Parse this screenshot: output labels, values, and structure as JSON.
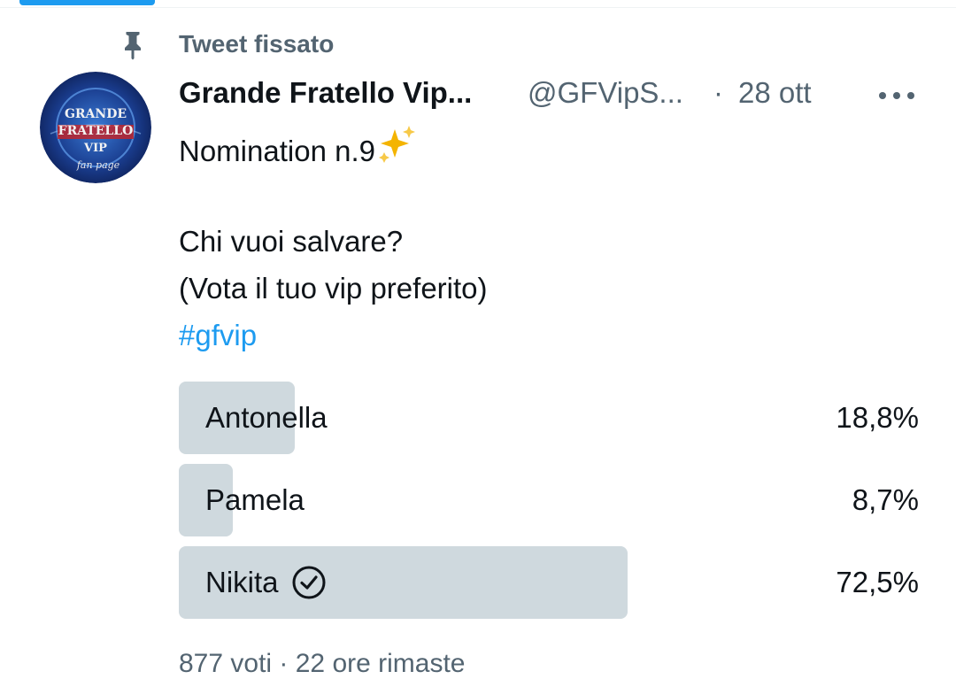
{
  "pinned": {
    "label": "Tweet fissato",
    "icon": "pin-icon"
  },
  "avatar": {
    "lines": [
      "GRANDE",
      "FRATELLO",
      "VIP",
      "fan page"
    ]
  },
  "tweet": {
    "author_name": "Grande Fratello Vip...",
    "handle": "@GFVipS...",
    "separator": "·",
    "date": "28 ott",
    "line1": "Nomination n.9",
    "line2": "Chi vuoi salvare?",
    "line3": "(Vota il tuo vip preferito)",
    "hashtag": "#gfvip"
  },
  "poll": {
    "options": [
      {
        "label": "Antonella",
        "percent_text": "18,8%",
        "percent": 18.8,
        "winner": false
      },
      {
        "label": "Pamela",
        "percent_text": "8,7%",
        "percent": 8.7,
        "winner": false
      },
      {
        "label": "Nikita",
        "percent_text": "72,5%",
        "percent": 72.5,
        "winner": true
      }
    ],
    "footer": "877 voti · 22 ore rimaste"
  },
  "colors": {
    "accent": "#1d9bf0",
    "poll_fill": "#cfd9de",
    "secondary_text": "#536471"
  }
}
